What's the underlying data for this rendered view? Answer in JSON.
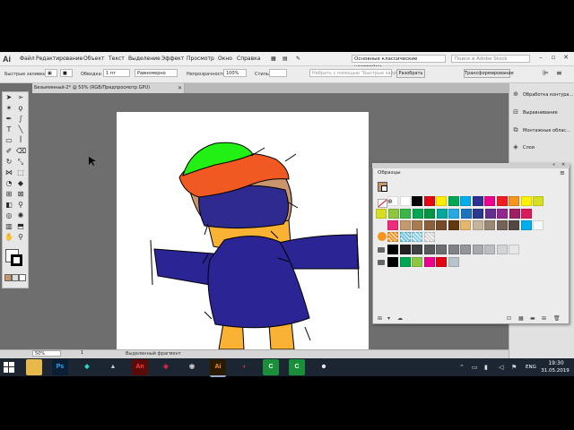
{
  "app": {
    "logo": "Ai",
    "menu": [
      "Файл",
      "Редактирование",
      "Объект",
      "Текст",
      "Выделение",
      "Эффект",
      "Просмотр",
      "Окно",
      "Справка"
    ],
    "workspace": "Основные классические настройки",
    "stock_search_placeholder": "Поиск в Adobe Stock"
  },
  "control_bar": {
    "group_label": "Быстрые заливки",
    "stroke_label": "Обводка:",
    "stroke_value": "1 пт",
    "stroke_profile": "Равномерно",
    "opacity_label": "Непрозрачность:",
    "opacity_value": "100%",
    "style_label": "Стиль:",
    "doc_hint": "Набрать с помощью \"Быстрые заливки\"",
    "btn_stop": "Разобрать",
    "btn_transform": "Трансформирование"
  },
  "document": {
    "tab_title": "Безымянный-2* @ 50% (RGB/Предпросмотр GPU)",
    "zoom": "50%",
    "artboard_number": "1",
    "status": "Выделенный фрагмент"
  },
  "right_dock": {
    "items": [
      "Обработка контура...",
      "Выравнивание",
      "Монтажные облас...",
      "Слои"
    ]
  },
  "swatches": {
    "title": "Образцы",
    "rows": [
      [
        "#ffffff",
        "#ffffff",
        "#000000",
        "#e30613",
        "#ffed00",
        "#00a651",
        "#00aeef",
        "#2e3192",
        "#ec008c",
        "#ee1d23",
        "#f7941d",
        "#fff200",
        "#d7df23"
      ],
      [
        "#d7df23",
        "#8dc63f",
        "#39b54a",
        "#00a651",
        "#009444",
        "#00a99d",
        "#27aae1",
        "#1c75bc",
        "#2b3990",
        "#662d91",
        "#92278f",
        "#9e1f63",
        "#da1c5c"
      ],
      [
        "#ee2a7b",
        "#c49a6c",
        "#a97c50",
        "#8b5e3c",
        "#754c29",
        "#603913",
        "#e6b66c",
        "#c2b59b",
        "#998675",
        "#736357",
        "#534741",
        "#00aeef",
        "#f7f7f7"
      ],
      [
        "#000000",
        "#231f20",
        "#414042",
        "#58595b",
        "#6d6e71",
        "#808285",
        "#939598",
        "#a7a9ac",
        "#bcbec0",
        "#d1d3d4",
        "#e6e7e8"
      ],
      [
        "#000000",
        "#00a651",
        "#8dc63f",
        "#ec008c",
        "#e30613",
        "#b8c4cc"
      ]
    ],
    "pattern_colors": [
      "#f7941d",
      "#6fc7e6",
      "#8ad0e8",
      "#d9d9d9"
    ]
  },
  "taskbar": {
    "lang": "ENG",
    "time": "19:30",
    "date": "31.05.2019"
  },
  "colors": {
    "canvas_bg": "#6e6e6e",
    "hat_green": "#22ef14",
    "hat_orange": "#f05a22",
    "face_skin": "#c9956b",
    "mask_blue": "#2e2a8f",
    "body_blue": "#2a2494",
    "leg_orange": "#f9b233"
  }
}
